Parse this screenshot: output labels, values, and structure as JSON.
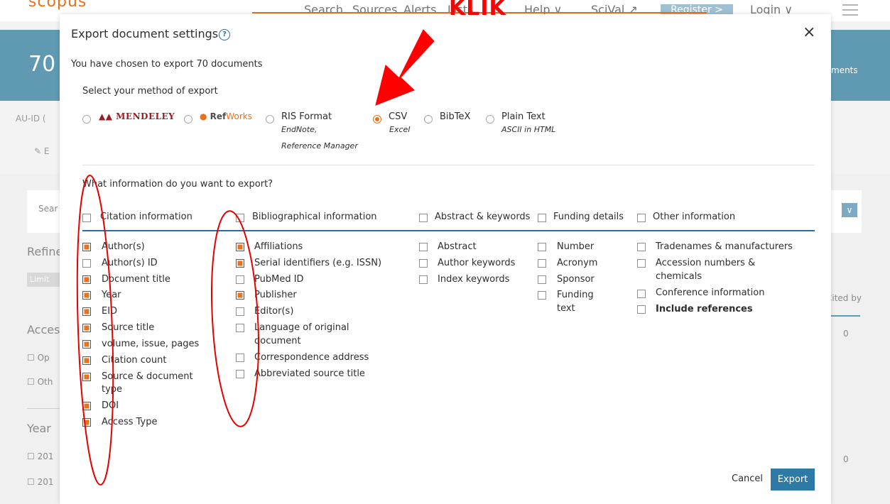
{
  "background": {
    "logo": "scopus",
    "nav": [
      "Search",
      "Sources",
      "Alerts",
      "Lists",
      "Help ∨",
      "SciVal ↗"
    ],
    "register": "Register >",
    "login": "Login ∨",
    "doc_count": "70",
    "banner_right": "ments",
    "au_id": "AU-ID (",
    "edit": "E",
    "search_label": "Sear",
    "refine": "Refine",
    "limit": "Limit",
    "cited_by": "Cited by",
    "access": "Acces",
    "access_op": "Op",
    "access_ot": "Oth",
    "year": "Year",
    "year1": "201",
    "year2": "201",
    "zero1": "0",
    "zero2": "0"
  },
  "modal": {
    "title": "Export document settings",
    "help_icon_text": "?",
    "close": "×",
    "chosen_text": "You have chosen to export 70 documents",
    "method_label": "Select your method of export",
    "methods": {
      "mendeley": "MENDELEY",
      "refworks_ref": "Ref",
      "refworks_works": "Works",
      "ris": {
        "label": "RIS Format",
        "sub1": "EndNote,",
        "sub2": "Reference Manager"
      },
      "csv": {
        "label": "CSV",
        "sub1": "Excel"
      },
      "bibtex": {
        "label": "BibTeX"
      },
      "plain": {
        "label": "Plain Text",
        "sub1": "ASCII in HTML"
      }
    },
    "selected_method": "CSV",
    "info_label": "What information do you want to export?",
    "columns": {
      "citation": {
        "header": "Citation information",
        "items": [
          "Author(s)",
          "Author(s) ID",
          "Document title",
          "Year",
          "EID",
          "Source title",
          "volume, issue, pages",
          "Citation count",
          "Source & document",
          "type",
          "DOI",
          "Access Type"
        ]
      },
      "biblio": {
        "header": "Bibliographical information",
        "items": [
          "Affiliations",
          "Serial identifiers (e.g. ISSN)",
          "PubMed ID",
          "Publisher",
          "Editor(s)",
          "Language of original",
          "document",
          "Correspondence address",
          "Abbreviated source title"
        ]
      },
      "abstract": {
        "header": "Abstract & keywords",
        "items": [
          "Abstract",
          "Author keywords",
          "Index keywords"
        ]
      },
      "funding": {
        "header": "Funding details",
        "items": [
          "Number",
          "Acronym",
          "Sponsor",
          "Funding",
          "text"
        ]
      },
      "other": {
        "header": "Other information",
        "items": [
          "Tradenames & manufacturers",
          "Accession numbers &",
          "chemicals",
          "Conference information",
          "Include references"
        ]
      }
    },
    "cancel": "Cancel",
    "export": "Export"
  },
  "annotation": {
    "klik": "KLIK",
    "color": "#ff0000"
  },
  "colors": {
    "accent": "#e9711c",
    "brand_blue": "#2d6ca2",
    "export_button": "#2d7aa6",
    "banner": "#5f99b2"
  }
}
